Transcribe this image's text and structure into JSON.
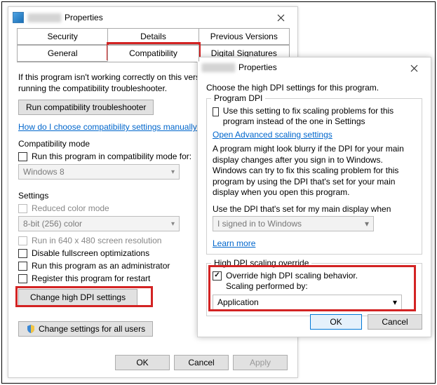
{
  "dialog1": {
    "title_suffix": "Properties",
    "tabs_row1": [
      "Security",
      "Details",
      "Previous Versions"
    ],
    "tabs_row2": [
      "General",
      "Compatibility",
      "Digital Signatures"
    ],
    "active_tab": "Compatibility",
    "intro_text": "If this program isn't working correctly on this version of Windows, try running the compatibility troubleshooter.",
    "run_troubleshooter_btn": "Run compatibility troubleshooter",
    "manual_link": "How do I choose compatibility settings manually?",
    "compat_mode_label": "Compatibility mode",
    "compat_mode_chk": "Run this program in compatibility mode for:",
    "compat_mode_value": "Windows 8",
    "settings_label": "Settings",
    "reduced_color_chk": "Reduced color mode",
    "reduced_color_value": "8-bit (256) color",
    "run640_chk": "Run in 640 x 480 screen resolution",
    "disable_fullscreen_chk": "Disable fullscreen optimizations",
    "run_admin_chk": "Run this program as an administrator",
    "register_restart_chk": "Register this program for restart",
    "change_dpi_btn": "Change high DPI settings",
    "change_all_users_btn": "Change settings for all users",
    "ok_btn": "OK",
    "cancel_btn": "Cancel",
    "apply_btn": "Apply"
  },
  "dialog2": {
    "title_suffix": "Properties",
    "intro": "Choose the high DPI settings for this program.",
    "group1_legend": "Program DPI",
    "use_setting_chk": "Use this setting to fix scaling problems for this program instead of the one in Settings",
    "open_advanced_link": "Open Advanced scaling settings",
    "blurry_text": "A program might look blurry if the DPI for your main display changes after you sign in to Windows. Windows can try to fix this scaling problem for this program by using the DPI that's set for your main display when you open this program.",
    "use_dpi_label": "Use the DPI that's set for my main display when",
    "use_dpi_value": "I signed in to Windows",
    "learn_more": "Learn more",
    "group2_legend": "High DPI scaling override",
    "override_chk_line1": "Override high DPI scaling behavior.",
    "override_chk_line2": "Scaling performed by:",
    "override_value": "Application",
    "ok_btn": "OK",
    "cancel_btn": "Cancel"
  }
}
